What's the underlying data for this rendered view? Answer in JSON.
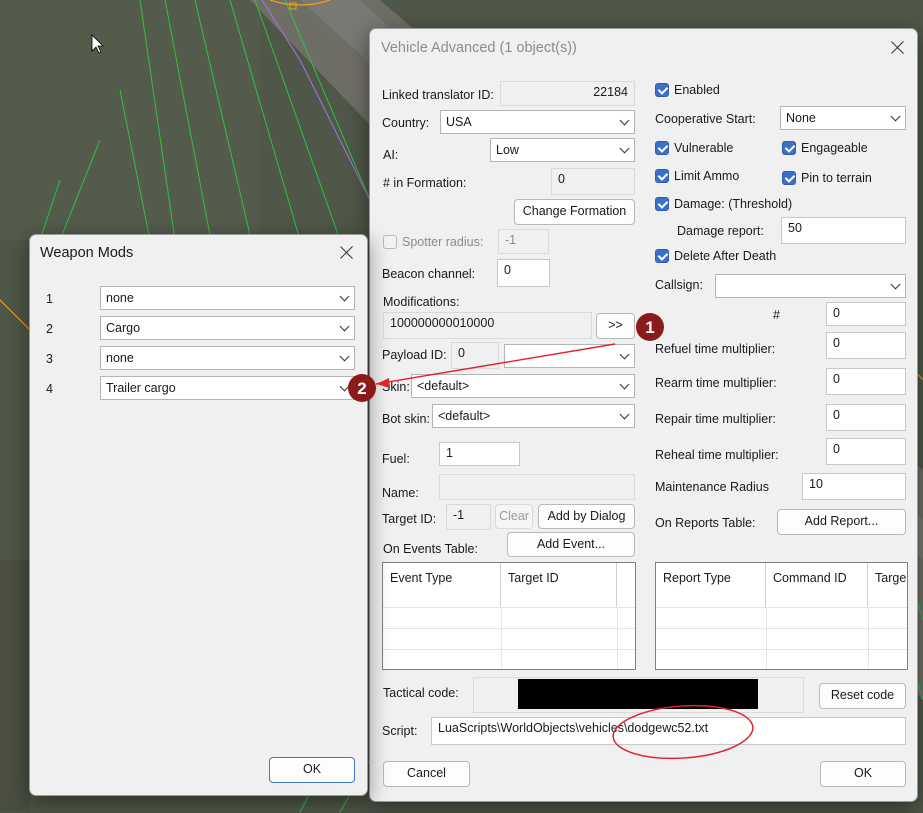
{
  "weapon_mods": {
    "title": "Weapon Mods",
    "rows": [
      {
        "index": "1",
        "value": "none"
      },
      {
        "index": "2",
        "value": "Cargo"
      },
      {
        "index": "3",
        "value": "none"
      },
      {
        "index": "4",
        "value": "Trailer cargo"
      }
    ],
    "ok_label": "OK"
  },
  "vehicle_advanced": {
    "title": "Vehicle Advanced (1 object(s))",
    "linked_translator_label": "Linked translator ID:",
    "linked_translator_value": "22184",
    "country_label": "Country:",
    "country_value": "USA",
    "ai_label": "AI:",
    "ai_value": "Low",
    "in_formation_label": "# in Formation:",
    "in_formation_value": "0",
    "change_formation_label": "Change Formation",
    "spotter_radius_label": "Spotter radius:",
    "spotter_radius_value": "-1",
    "beacon_channel_label": "Beacon channel:",
    "beacon_channel_value": "0",
    "modifications_label": "Modifications:",
    "modifications_value": "100000000010000",
    "modifications_button": ">>",
    "payload_id_label": "Payload ID:",
    "payload_id_value": "0",
    "payload_select_value": "",
    "skin_label": "Skin:",
    "skin_value": "<default>",
    "bot_skin_label": "Bot skin:",
    "bot_skin_value": "<default>",
    "fuel_label": "Fuel:",
    "fuel_value": "1",
    "name_label": "Name:",
    "name_value": "",
    "target_id_label": "Target ID:",
    "target_id_value": "-1",
    "clear_label": "Clear",
    "add_by_dialog_label": "Add by Dialog",
    "on_events_label": "On Events Table:",
    "add_event_label": "Add Event...",
    "events_columns": [
      "Event Type",
      "Target ID"
    ],
    "enabled_label": "Enabled",
    "cooperative_start_label": "Cooperative Start:",
    "cooperative_start_value": "None",
    "vulnerable_label": "Vulnerable",
    "engageable_label": "Engageable",
    "limit_ammo_label": "Limit Ammo",
    "pin_to_terrain_label": "Pin to terrain",
    "damage_label": "Damage: (Threshold)",
    "damage_report_label": "Damage report:",
    "damage_report_value": "50",
    "delete_after_death_label": "Delete After Death",
    "callsign_label": "Callsign:",
    "callsign_value": "",
    "callsign_num_label": "#",
    "callsign_num_value": "0",
    "refuel_label": "Refuel time multiplier:",
    "refuel_value": "0",
    "rearm_label": "Rearm time multiplier:",
    "rearm_value": "0",
    "repair_label": "Repair time multiplier:",
    "repair_value": "0",
    "reheal_label": "Reheal time multiplier:",
    "reheal_value": "0",
    "maintenance_radius_label": "Maintenance Radius",
    "maintenance_radius_value": "10",
    "on_reports_label": "On Reports Table:",
    "add_report_label": "Add Report...",
    "reports_columns": [
      "Report Type",
      "Command ID",
      "Targe"
    ],
    "tactical_code_label": "Tactical code:",
    "reset_code_label": "Reset code",
    "script_label": "Script:",
    "script_value": "LuaScripts\\WorldObjects\\vehicles\\dodgewc52.txt",
    "cancel_label": "Cancel",
    "ok_label": "OK"
  },
  "annotations": {
    "marker_1": "1",
    "marker_2": "2",
    "marker_color": "#8b1a1a",
    "arrow_color": "#e0242b"
  }
}
